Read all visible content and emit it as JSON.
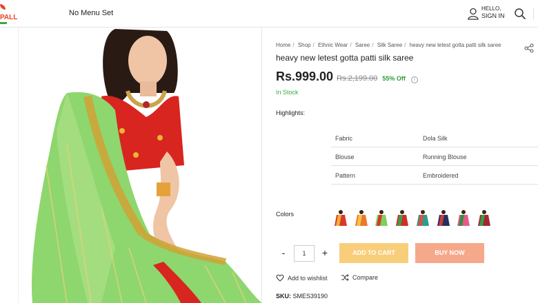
{
  "header": {
    "logo_text": "PALL",
    "menu_text": "No Menu Set",
    "hello_text": "HELLO,",
    "signin_text": "SIGN IN"
  },
  "breadcrumb": [
    "Home",
    "Shop",
    "Ethnic Wear",
    "Saree",
    "Silk Saree",
    "heavy new letest gotta patti silk saree"
  ],
  "product": {
    "title": "heavy new letest gotta patti silk saree",
    "price": "Rs.999.00",
    "mrp": "Rs.2,199.00",
    "discount": "55% Off",
    "stock_status": "In Stock",
    "highlights_label": "Highlights:",
    "specs": [
      {
        "key": "Fabric",
        "value": "Dola Silk"
      },
      {
        "key": "Blouse",
        "value": "Running Blouse"
      },
      {
        "key": "Pattern",
        "value": "Embroidered"
      }
    ],
    "colors_label": "Colors",
    "color_swatches": [
      {
        "name": "red",
        "primary": "#d93a2b",
        "accent": "#f3b03a"
      },
      {
        "name": "orange",
        "primary": "#e8792a",
        "accent": "#f6c24a"
      },
      {
        "name": "green",
        "primary": "#7fcf5c",
        "accent": "#d8362c"
      },
      {
        "name": "red-green",
        "primary": "#cf2e2a",
        "accent": "#3aa04a"
      },
      {
        "name": "teal",
        "primary": "#2f9b8c",
        "accent": "#e34b3a"
      },
      {
        "name": "navy",
        "primary": "#26305e",
        "accent": "#d23a3a"
      },
      {
        "name": "pink",
        "primary": "#e65a8a",
        "accent": "#2f8f3f"
      },
      {
        "name": "maroon",
        "primary": "#a32631",
        "accent": "#3a9a4a"
      }
    ],
    "quantity": "1",
    "sku_label": "SKU:",
    "sku_value": "SMES39190"
  },
  "actions": {
    "minus": "-",
    "plus": "+",
    "add_to_cart": "ADD TO CART",
    "buy_now": "BUY NOW",
    "wishlist": "Add to wishlist",
    "compare": "Compare"
  },
  "colors": {
    "add_to_cart_bg": "#f9ce7a",
    "buy_now_bg": "#f6a98a",
    "in_stock": "#3aa84a",
    "discount": "#2b9a3a",
    "brand": "#e8431f"
  }
}
